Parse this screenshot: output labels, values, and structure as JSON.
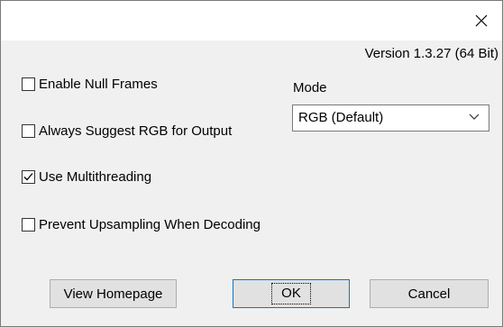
{
  "version": "Version 1.3.27 (64 Bit)",
  "options": [
    {
      "label": "Enable Null Frames",
      "checked": false
    },
    {
      "label": "Always Suggest RGB for Output",
      "checked": false
    },
    {
      "label": "Use Multithreading",
      "checked": true
    },
    {
      "label": "Prevent Upsampling When Decoding",
      "checked": false
    }
  ],
  "mode": {
    "label": "Mode",
    "selected": "RGB (Default)"
  },
  "buttons": {
    "homepage": "View Homepage",
    "ok": "OK",
    "cancel": "Cancel"
  },
  "icons": {
    "close": "close-icon",
    "dropdown": "chevron-down-icon",
    "check": "checkmark-icon"
  }
}
